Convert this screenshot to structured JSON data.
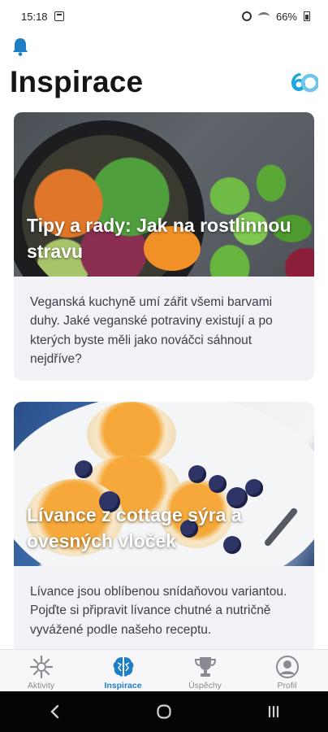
{
  "status_bar": {
    "time": "15:18",
    "battery": "66%"
  },
  "header": {
    "title": "Inspirace"
  },
  "feed": [
    {
      "title": "Tipy a rady: Jak na rostlinnou stravu",
      "description": "Veganská kuchyně umí zářit všemi barvami duhy. Jaké veganské potraviny existují a po kterých byste měli jako nováčci sáhnout nejdříve?"
    },
    {
      "title": "Lívance z cottage sýra a ovesných vloček",
      "description": "Lívance jsou oblíbenou snídaňovou variantou. Pojďte si připravit lívance chutné a nutričně vyvážené podle našeho receptu."
    }
  ],
  "bottom_nav": [
    {
      "label": "Aktivity",
      "icon": "activity-icon",
      "active": false
    },
    {
      "label": "Inspirace",
      "icon": "brain-icon",
      "active": true
    },
    {
      "label": "Úspěchy",
      "icon": "trophy-icon",
      "active": false
    },
    {
      "label": "Profil",
      "icon": "profile-icon",
      "active": false
    }
  ],
  "colors": {
    "accent": "#1f7fc4",
    "inactive": "#8a8a92",
    "card_background": "#f1f1f6"
  }
}
